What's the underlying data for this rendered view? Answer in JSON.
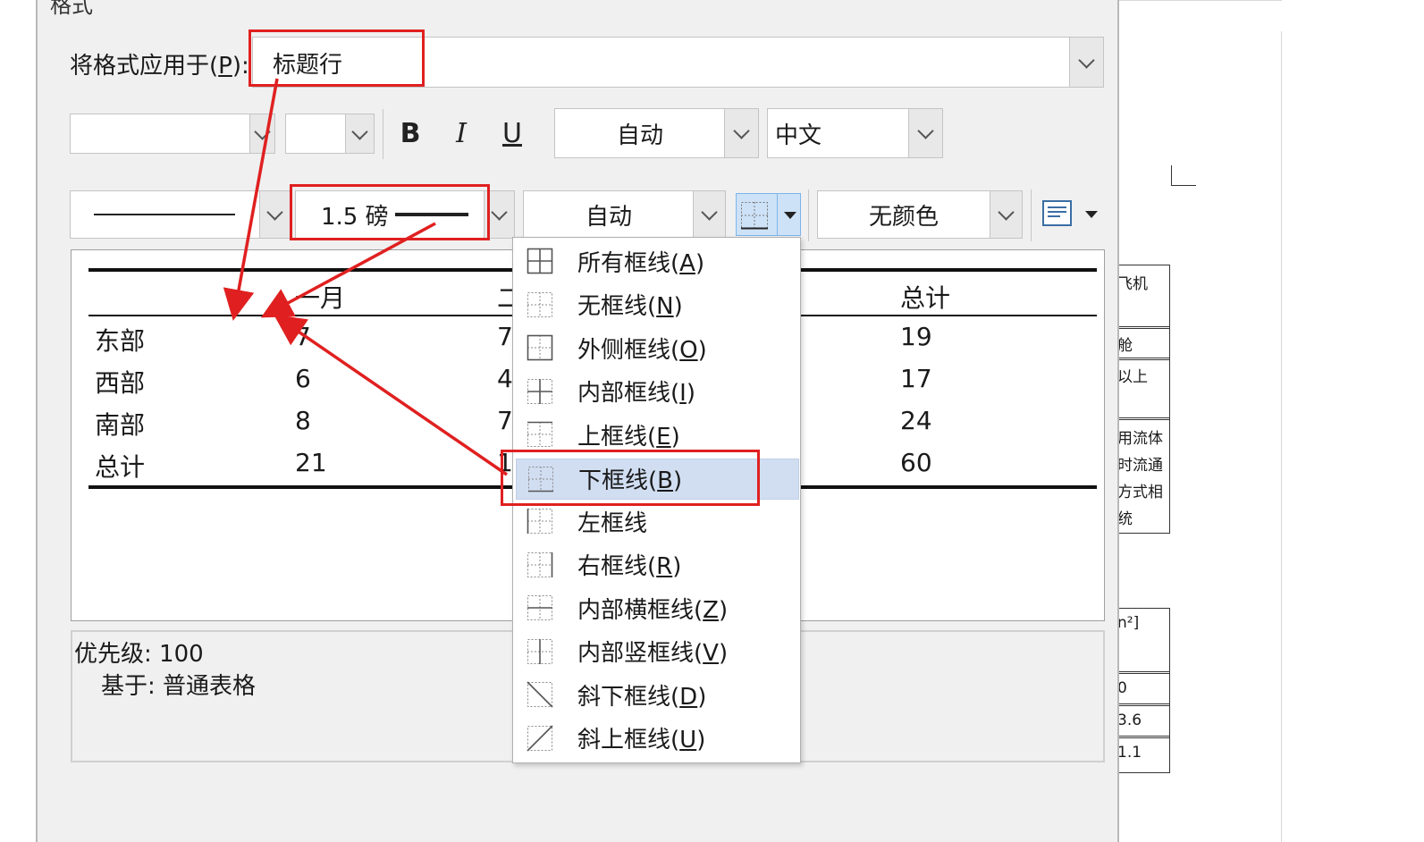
{
  "dialog": {
    "group_title": "格式",
    "apply_to": {
      "label": "将格式应用于(P):",
      "label_prefix": "将格式应用于(",
      "label_key": "P",
      "label_suffix": "):",
      "value": "标题行"
    },
    "font": {
      "name_value": "",
      "size_value": "",
      "bold": "B",
      "italic": "I",
      "underline": "U",
      "color_value": "自动",
      "script_value": "中文"
    },
    "border": {
      "line_weight_value": "1.5 磅",
      "line_color_value": "自动",
      "shading_value": "无颜色"
    }
  },
  "preview": {
    "headers": [
      "",
      "一月",
      "二",
      "",
      "总计"
    ],
    "rows": [
      {
        "label": "东部",
        "c1": "7",
        "c2": "7",
        "total": "19"
      },
      {
        "label": "西部",
        "c1": "6",
        "c2": "4",
        "total": "17"
      },
      {
        "label": "南部",
        "c1": "8",
        "c2": "7",
        "total": "24"
      },
      {
        "label": "总计",
        "c1": "21",
        "c2": "1",
        "total": "60"
      }
    ]
  },
  "description": {
    "priority": "优先级: 100",
    "based_on": "基于: 普通表格"
  },
  "border_menu": {
    "items": [
      {
        "label": "所有框线",
        "key": "A",
        "icon": "all-borders-icon"
      },
      {
        "label": "无框线",
        "key": "N",
        "icon": "no-border-icon"
      },
      {
        "label": "外侧框线",
        "key": "O",
        "icon": "outside-borders-icon"
      },
      {
        "label": "内部框线",
        "key": "I",
        "icon": "inside-borders-icon"
      },
      {
        "label": "上框线",
        "key": "E",
        "icon": "top-border-icon"
      },
      {
        "label": "下框线",
        "key": "B",
        "icon": "bottom-border-icon",
        "selected": true
      },
      {
        "label": "左框线",
        "key": "",
        "icon": "left-border-icon"
      },
      {
        "label": "右框线",
        "key": "R",
        "icon": "right-border-icon"
      },
      {
        "label": "内部横框线",
        "key": "Z",
        "icon": "inside-horizontal-border-icon"
      },
      {
        "label": "内部竖框线",
        "key": "V",
        "icon": "inside-vertical-border-icon"
      },
      {
        "label": "斜下框线",
        "key": "D",
        "icon": "diagonal-down-border-icon"
      },
      {
        "label": "斜上框线",
        "key": "U",
        "icon": "diagonal-up-border-icon"
      }
    ]
  },
  "background_document": {
    "cells": [
      "飞机",
      "舱",
      "以上",
      "用流体",
      "时流通",
      "方式相",
      "统",
      "n²]",
      "0",
      "3.6",
      "1.1"
    ]
  },
  "colors": {
    "annotation_red": "#e02020",
    "menu_highlight": "#d1def2",
    "dialog_bg": "#f0f0f0"
  }
}
